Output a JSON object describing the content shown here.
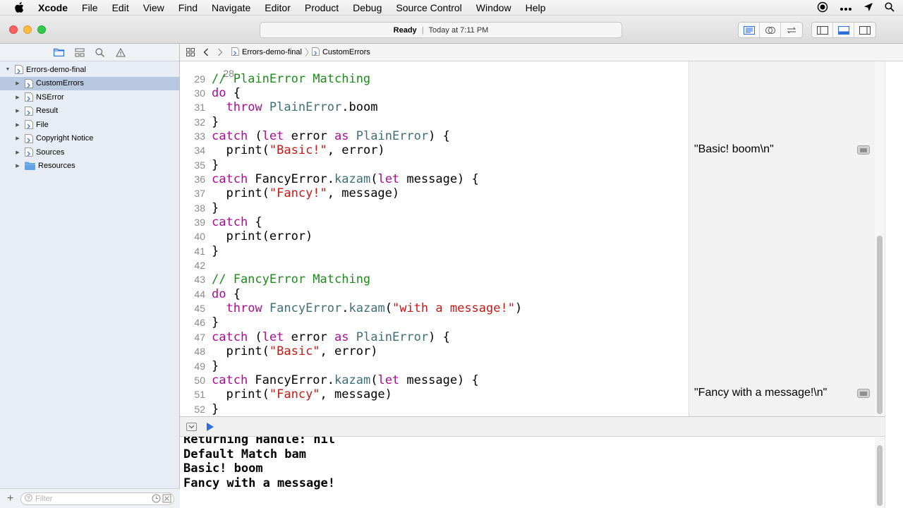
{
  "menubar": {
    "app_name": "Xcode",
    "items": [
      "File",
      "Edit",
      "View",
      "Find",
      "Navigate",
      "Editor",
      "Product",
      "Debug",
      "Source Control",
      "Window",
      "Help"
    ],
    "status_icons": [
      "record-icon",
      "more-icon",
      "location-icon",
      "search-icon"
    ]
  },
  "toolbar": {
    "status": "Ready",
    "separator": "|",
    "timestamp": "Today at 7:11 PM"
  },
  "navigator": {
    "tabs": [
      "folder-icon",
      "hierarchy-icon",
      "search-icon",
      "warning-icon"
    ],
    "project": "Errors-demo-final",
    "items": [
      {
        "label": "CustomErrors",
        "type": "page",
        "selected": true
      },
      {
        "label": "NSError",
        "type": "page"
      },
      {
        "label": "Result",
        "type": "page"
      },
      {
        "label": "File",
        "type": "page"
      },
      {
        "label": "Copyright Notice",
        "type": "page"
      },
      {
        "label": "Sources",
        "type": "page"
      },
      {
        "label": "Resources",
        "type": "folder"
      }
    ],
    "filter_placeholder": "Filter"
  },
  "jumpbar": {
    "crumbs": [
      "Errors-demo-final",
      "CustomErrors"
    ]
  },
  "editor": {
    "partial_top_line": "28",
    "lines": [
      {
        "n": "29",
        "t": [
          [
            "cm",
            "// PlainError Matching"
          ]
        ]
      },
      {
        "n": "30",
        "t": [
          [
            "kw",
            "do"
          ],
          [
            "tx",
            " {"
          ]
        ]
      },
      {
        "n": "31",
        "t": [
          [
            "tx",
            "  "
          ],
          [
            "kw",
            "throw"
          ],
          [
            "tx",
            " "
          ],
          [
            "ty",
            "PlainError"
          ],
          [
            "tx",
            ".boom"
          ]
        ]
      },
      {
        "n": "32",
        "t": [
          [
            "tx",
            "}"
          ]
        ]
      },
      {
        "n": "33",
        "t": [
          [
            "kw",
            "catch"
          ],
          [
            "tx",
            " ("
          ],
          [
            "kw",
            "let"
          ],
          [
            "tx",
            " error "
          ],
          [
            "kw",
            "as"
          ],
          [
            "tx",
            " "
          ],
          [
            "ty",
            "PlainError"
          ],
          [
            "tx",
            ") {"
          ]
        ]
      },
      {
        "n": "34",
        "t": [
          [
            "tx",
            "  print("
          ],
          [
            "st",
            "\"Basic!\""
          ],
          [
            "tx",
            ", error)"
          ]
        ]
      },
      {
        "n": "35",
        "t": [
          [
            "tx",
            "}"
          ]
        ]
      },
      {
        "n": "36",
        "t": [
          [
            "kw",
            "catch"
          ],
          [
            "tx",
            " FancyError."
          ],
          [
            "mb",
            "kazam"
          ],
          [
            "tx",
            "("
          ],
          [
            "kw",
            "let"
          ],
          [
            "tx",
            " message) {"
          ]
        ]
      },
      {
        "n": "37",
        "t": [
          [
            "tx",
            "  print("
          ],
          [
            "st",
            "\"Fancy!\""
          ],
          [
            "tx",
            ", message)"
          ]
        ]
      },
      {
        "n": "38",
        "t": [
          [
            "tx",
            "}"
          ]
        ]
      },
      {
        "n": "39",
        "t": [
          [
            "kw",
            "catch"
          ],
          [
            "tx",
            " {"
          ]
        ]
      },
      {
        "n": "40",
        "t": [
          [
            "tx",
            "  print(error)"
          ]
        ]
      },
      {
        "n": "41",
        "t": [
          [
            "tx",
            "}"
          ]
        ]
      },
      {
        "n": "42",
        "t": []
      },
      {
        "n": "43",
        "t": [
          [
            "cm",
            "// FancyError Matching"
          ]
        ]
      },
      {
        "n": "44",
        "t": [
          [
            "kw",
            "do"
          ],
          [
            "tx",
            " {"
          ]
        ]
      },
      {
        "n": "45",
        "t": [
          [
            "tx",
            "  "
          ],
          [
            "kw",
            "throw"
          ],
          [
            "tx",
            " "
          ],
          [
            "ty",
            "FancyError"
          ],
          [
            "tx",
            "."
          ],
          [
            "mb",
            "kazam"
          ],
          [
            "tx",
            "("
          ],
          [
            "st",
            "\"with a message!\""
          ],
          [
            "tx",
            ")"
          ]
        ]
      },
      {
        "n": "46",
        "t": [
          [
            "tx",
            "}"
          ]
        ]
      },
      {
        "n": "47",
        "t": [
          [
            "kw",
            "catch"
          ],
          [
            "tx",
            " ("
          ],
          [
            "kw",
            "let"
          ],
          [
            "tx",
            " error "
          ],
          [
            "kw",
            "as"
          ],
          [
            "tx",
            " "
          ],
          [
            "ty",
            "PlainError"
          ],
          [
            "tx",
            ") {"
          ]
        ]
      },
      {
        "n": "48",
        "t": [
          [
            "tx",
            "  print("
          ],
          [
            "st",
            "\"Basic\""
          ],
          [
            "tx",
            ", error)"
          ]
        ]
      },
      {
        "n": "49",
        "t": [
          [
            "tx",
            "}"
          ]
        ]
      },
      {
        "n": "50",
        "t": [
          [
            "kw",
            "catch"
          ],
          [
            "tx",
            " FancyError."
          ],
          [
            "mb",
            "kazam"
          ],
          [
            "tx",
            "("
          ],
          [
            "kw",
            "let"
          ],
          [
            "tx",
            " message) {"
          ]
        ]
      },
      {
        "n": "51",
        "t": [
          [
            "tx",
            "  print("
          ],
          [
            "st",
            "\"Fancy\""
          ],
          [
            "tx",
            ", message)"
          ]
        ]
      },
      {
        "n": "52",
        "t": [
          [
            "tx",
            "}"
          ]
        ]
      }
    ]
  },
  "results": [
    {
      "line": "34",
      "text": "\"Basic! boom\\n\""
    },
    {
      "line": "51",
      "text": "\"Fancy with a message!\\n\""
    }
  ],
  "console": {
    "lines": [
      "Returning Handle: nil",
      "Default Match bam",
      "Basic! boom",
      "Fancy with a message!"
    ]
  },
  "colors": {
    "keyword": "#aa0d91",
    "comment": "#1f8a1c",
    "type": "#3f6e74",
    "string": "#c41a16",
    "selection": "#b8c8e0"
  }
}
